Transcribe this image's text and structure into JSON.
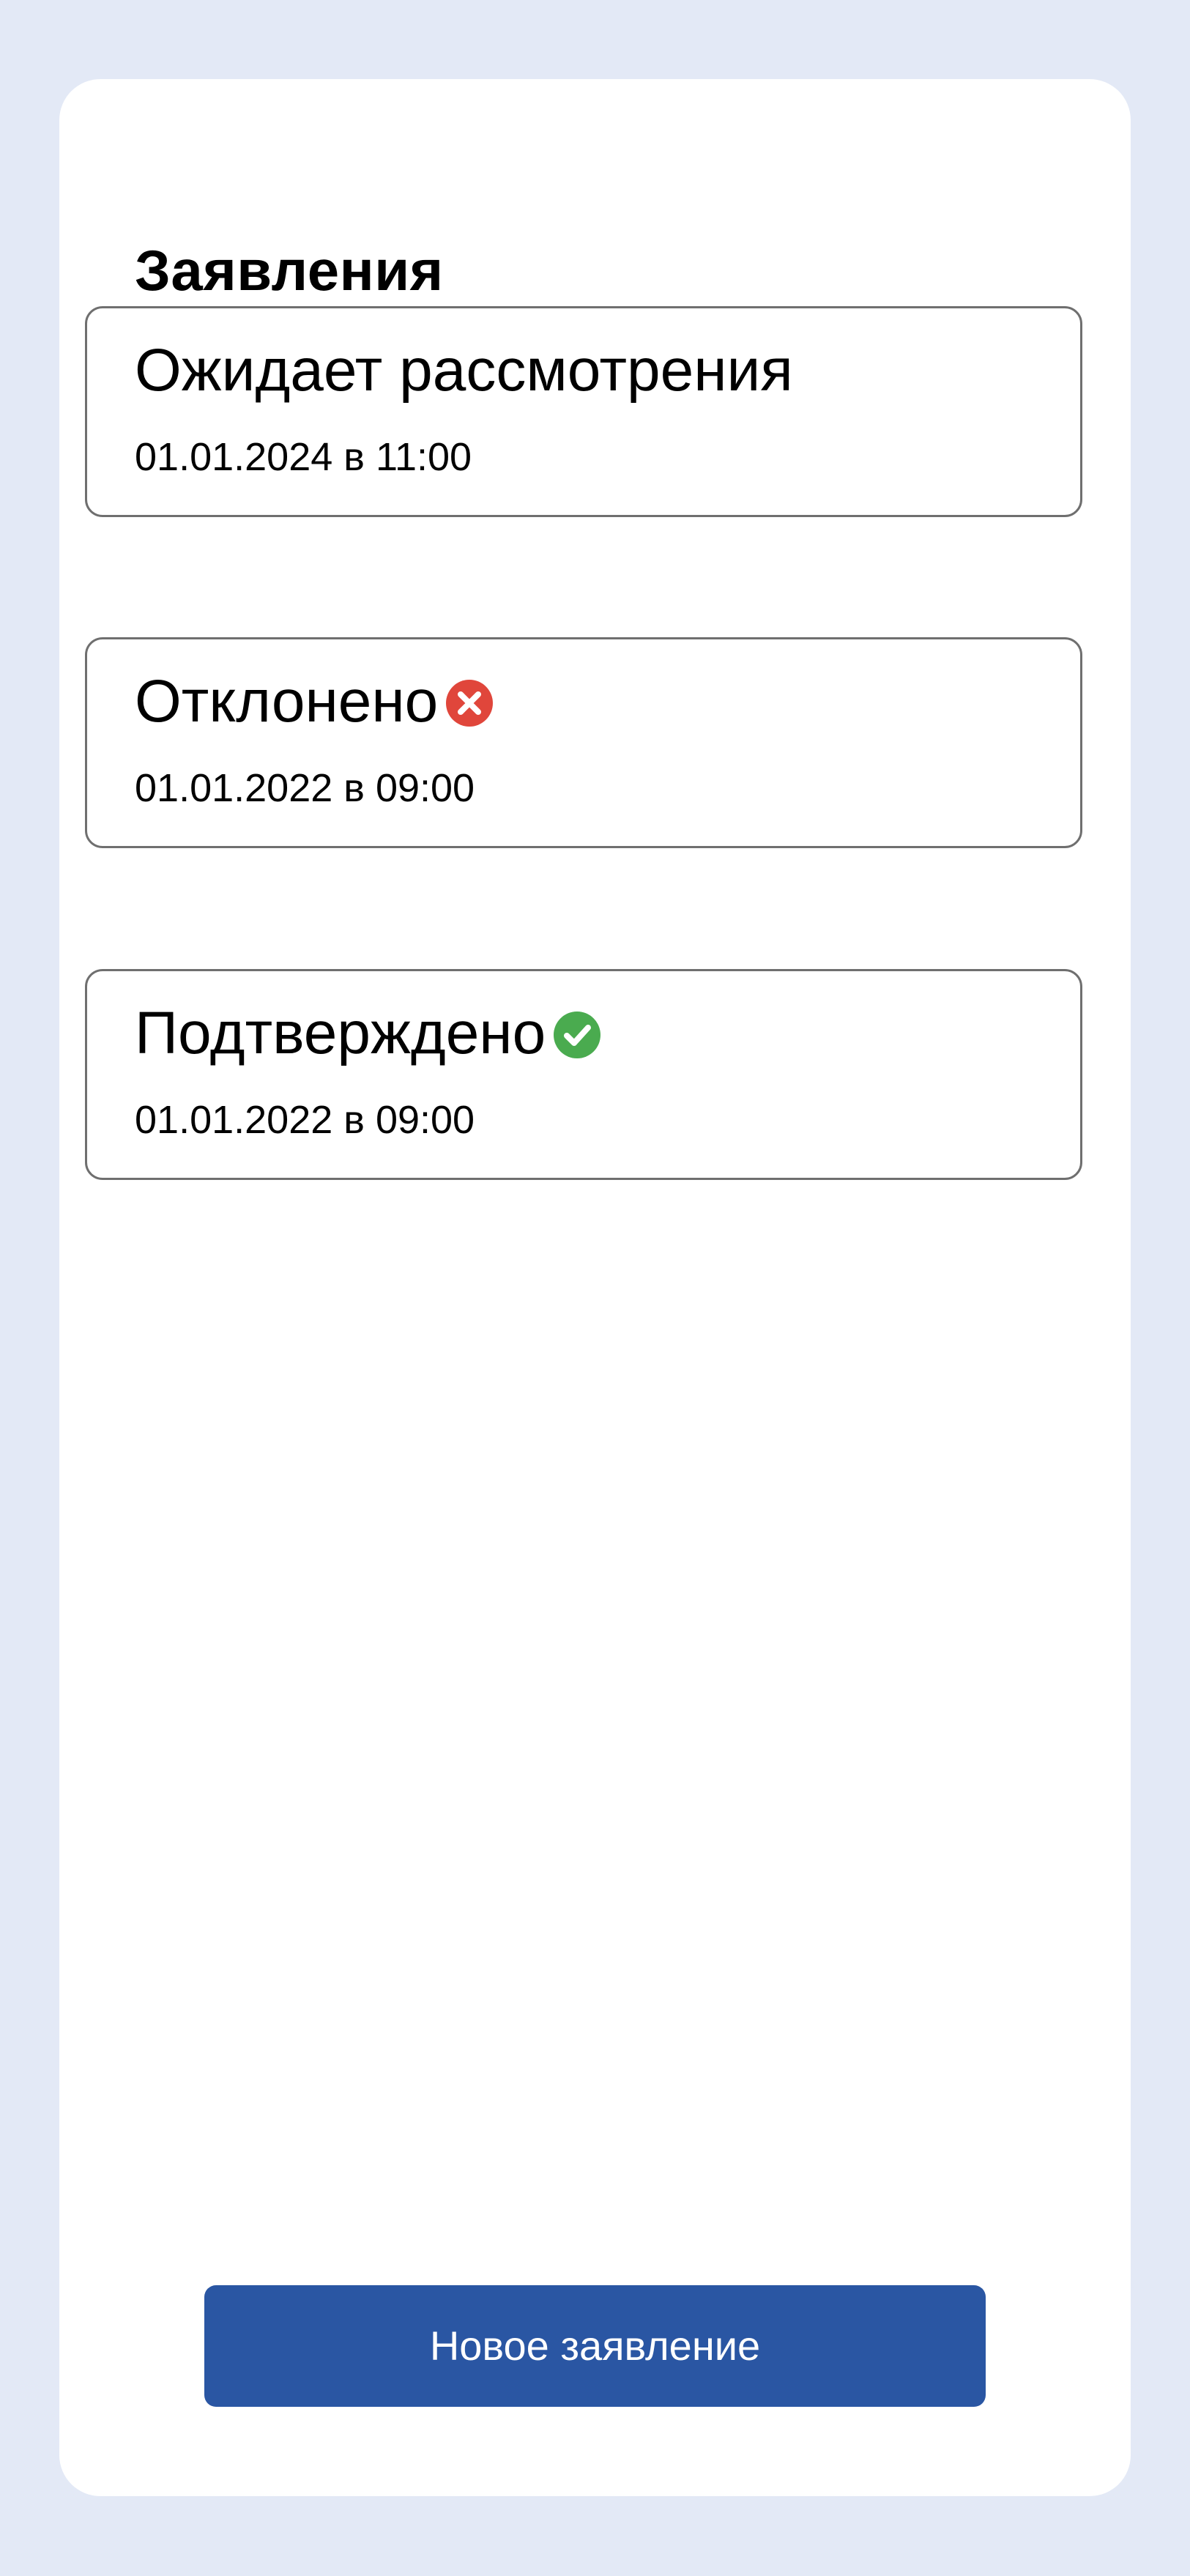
{
  "header": {
    "title": "Заявления"
  },
  "applications": [
    {
      "status": "Ожидает рассмотрения",
      "date": "01.01.2024 в 11:00",
      "status_icon": null
    },
    {
      "status": "Отклонено",
      "date": "01.01.2022 в 09:00",
      "status_icon": "rejected-icon"
    },
    {
      "status": "Подтверждено",
      "date": "01.01.2022 в 09:00",
      "status_icon": "approved-icon"
    }
  ],
  "actions": {
    "new_application_label": "Новое заявление"
  },
  "colors": {
    "page_background": "#e3e9f6",
    "panel_background": "#ffffff",
    "card_border": "#6f6f6f",
    "primary_button": "#2a56a3",
    "rejected": "#e0463b",
    "approved": "#4aab4f"
  }
}
